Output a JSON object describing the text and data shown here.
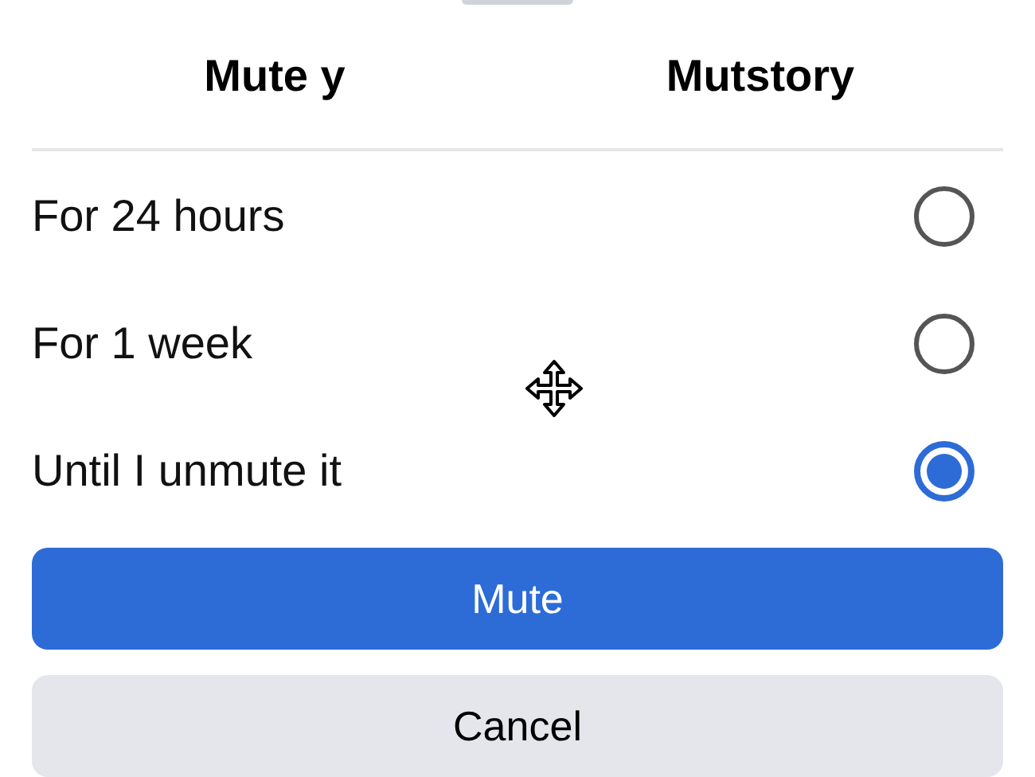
{
  "headers": [
    "Mute y",
    "Mutstory"
  ],
  "options": [
    {
      "label": "For 24 hours",
      "selected": false
    },
    {
      "label": "For 1 week",
      "selected": false
    },
    {
      "label": "Until I unmute it",
      "selected": true
    }
  ],
  "buttons": [
    {
      "label": "Mute",
      "kind": "primary"
    },
    {
      "label": "Cancel",
      "kind": "secondary"
    }
  ]
}
